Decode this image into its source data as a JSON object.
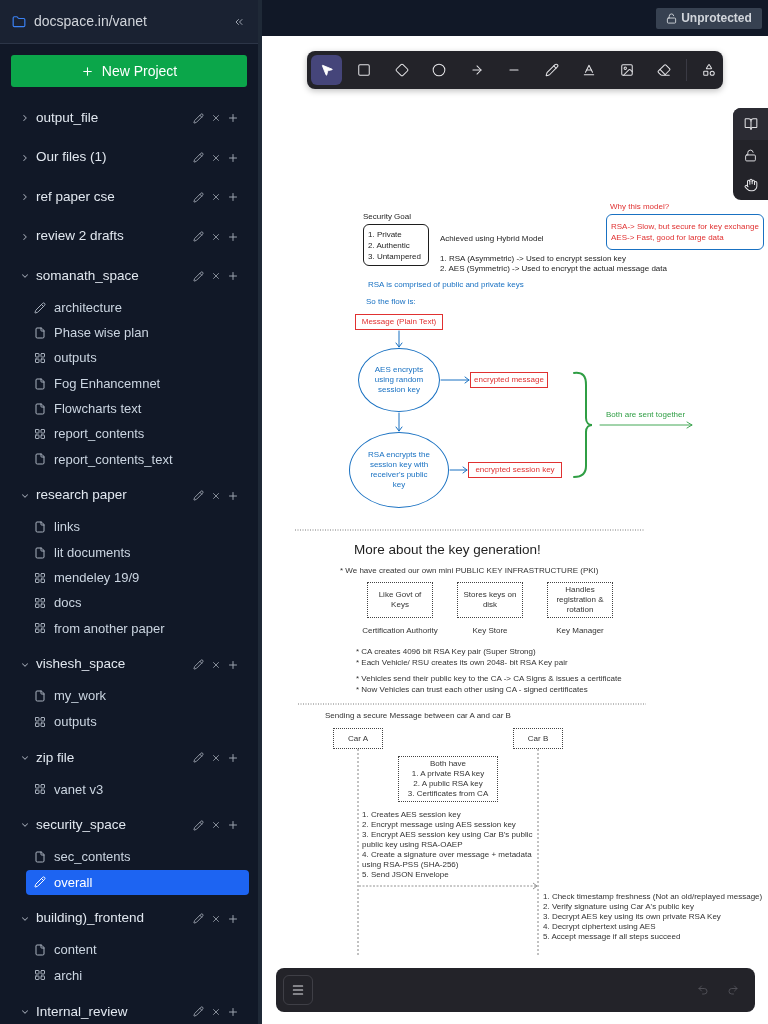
{
  "sidebar": {
    "workspace": "docspace.in/vanet",
    "new_project": "New Project",
    "projects": [
      {
        "name": "output_file",
        "expanded": false
      },
      {
        "name": "Our files (1)",
        "expanded": false
      },
      {
        "name": "ref paper cse",
        "expanded": false
      },
      {
        "name": "review 2 drafts",
        "expanded": false
      },
      {
        "name": "somanath_space",
        "expanded": true,
        "children": [
          {
            "name": "architecture",
            "kind": "drawing",
            "selected": false
          },
          {
            "name": "Phase wise plan",
            "kind": "document",
            "selected": false
          },
          {
            "name": "outputs",
            "kind": "board",
            "selected": false
          },
          {
            "name": "Fog Enhancemnet",
            "kind": "document",
            "selected": false
          },
          {
            "name": "Flowcharts text",
            "kind": "document",
            "selected": false
          },
          {
            "name": "report_contents",
            "kind": "board",
            "selected": false
          },
          {
            "name": "report_contents_text",
            "kind": "document",
            "selected": false
          }
        ]
      },
      {
        "name": "research paper",
        "expanded": true,
        "children": [
          {
            "name": "links",
            "kind": "document",
            "selected": false
          },
          {
            "name": "lit documents",
            "kind": "document",
            "selected": false
          },
          {
            "name": "mendeley 19/9",
            "kind": "board",
            "selected": false
          },
          {
            "name": "docs",
            "kind": "board",
            "selected": false
          },
          {
            "name": "from another paper",
            "kind": "board",
            "selected": false
          }
        ]
      },
      {
        "name": "vishesh_space",
        "expanded": true,
        "children": [
          {
            "name": "my_work",
            "kind": "document",
            "selected": false
          },
          {
            "name": "outputs",
            "kind": "board",
            "selected": false
          }
        ]
      },
      {
        "name": "zip file",
        "expanded": true,
        "children": [
          {
            "name": "vanet v3",
            "kind": "board",
            "selected": false
          }
        ]
      },
      {
        "name": "security_space",
        "expanded": true,
        "children": [
          {
            "name": "sec_contents",
            "kind": "document",
            "selected": false
          },
          {
            "name": "overall",
            "kind": "drawing",
            "selected": true
          }
        ]
      },
      {
        "name": "building)_frontend",
        "expanded": true,
        "children": [
          {
            "name": "content",
            "kind": "document",
            "selected": false
          },
          {
            "name": "archi",
            "kind": "board",
            "selected": false
          }
        ]
      },
      {
        "name": "Internal_review",
        "expanded": true
      }
    ]
  },
  "top_bar": {
    "protection_button": "Unprotected"
  },
  "toolbar": {
    "tools": [
      {
        "kind": "select",
        "selected": true
      },
      {
        "kind": "rectangle",
        "selected": false
      },
      {
        "kind": "diamond",
        "selected": false
      },
      {
        "kind": "ellipse",
        "selected": false
      },
      {
        "kind": "arrow",
        "selected": false
      },
      {
        "kind": "line",
        "selected": false
      },
      {
        "kind": "draw",
        "selected": false
      },
      {
        "kind": "text",
        "selected": false
      },
      {
        "kind": "image",
        "selected": false
      },
      {
        "kind": "eraser",
        "selected": false
      }
    ],
    "more_tools": [
      {
        "kind": "shapes",
        "selected": false
      }
    ]
  },
  "history": {
    "undo_disabled": true,
    "redo_disabled": true
  },
  "canvas": {
    "security_goal": {
      "title": "Security Goal",
      "items": [
        "1. Private",
        "2. Authentic",
        "3. Untampered"
      ]
    },
    "hybrid_model": {
      "title": "Achieved using Hybrid Model",
      "lines": [
        "1. RSA (Asymmetric) -> Used to encrypt session key",
        "2. AES (Symmetric) -> Used to encrypt the actual message data"
      ]
    },
    "rationale": {
      "title": "Why this model?",
      "lines": [
        "RSA-> Slow, but secure for key exchange",
        "AES-> Fast, good for large data"
      ]
    },
    "notes": [
      "RSA is comprised of public and private keys",
      "So the flow is:"
    ],
    "flow": {
      "message": "Message (Plain Text)",
      "aes_step": "AES encrypts using random session key",
      "encrypted_message": "encrypted message",
      "rsa_step": "RSA encrypts the session key with receiver's public key",
      "encrypted_key": "encrypted session key",
      "brace_label": "Both are sent together"
    },
    "pki": {
      "heading": "More about the key generation!",
      "intro": "* We have created our own mini PUBLIC KEY INFRASTRUCTURE (PKI)",
      "components": [
        {
          "description": "Like Govt of Keys",
          "label": "Certification Authority"
        },
        {
          "description": "Stores keys on disk",
          "label": "Key Store"
        },
        {
          "description": "Handles registration & rotation",
          "label": "Key Manager"
        }
      ],
      "bullet_groups": [
        [
          "* CA creates 4096 bit RSA Key pair (Super Strong)",
          "* Each Vehicle/ RSU creates its own 2048- bit RSA Key pair"
        ],
        [
          "* Vehicles send their public key to the CA -> CA Signs & issues a certificate",
          "* Now Vehicles can trust each other using CA - signed certificates"
        ]
      ]
    },
    "sequence": {
      "title": "Sending a secure Message between car A and car B",
      "actors": [
        "Car A",
        "Car B"
      ],
      "shared": {
        "title": "Both have",
        "items": [
          "1. A private RSA key",
          "2. A public RSA key",
          "3. Certificates from CA"
        ]
      },
      "sender_steps": [
        "1. Creates AES session key",
        "2. Encrypt message using AES session key",
        "3. Encrypt AES session key using Car B's public public key using RSA-OAEP",
        "4. Create a signature over message + metadata using RSA-PSS (SHA-256)",
        "5. Send JSON Envelope"
      ],
      "receiver_steps": [
        "1. Check timestamp freshness (Not an old/replayed message)",
        "2. Verify signature using Car A's public key",
        "3. Decrypt AES key using its own private RSA Key",
        "4. Decrypt ciphertext using AES",
        "5. Accept message if all steps succeed"
      ]
    }
  }
}
